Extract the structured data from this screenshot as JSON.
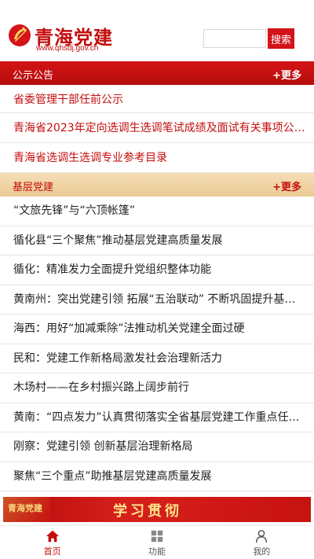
{
  "header": {
    "title": "青海党建",
    "url": "www.qhsdj.gov.cn",
    "search_placeholder": "",
    "search_button": "搜索"
  },
  "notice": {
    "title": "公示公告",
    "more": "+更多",
    "items": [
      "省委管理干部任前公示",
      "青海省2023年定向选调生选调笔试成绩及面试有关事项公…",
      "青海省选调生选调专业参考目录"
    ]
  },
  "grassroots": {
    "title": "基层党建",
    "more": "+更多",
    "items": [
      "“文旅先锋”与“六顶帐篷”",
      "循化县“三个聚焦”推动基层党建高质量发展",
      "循化：精准发力全面提升党组织整体功能",
      "黄南州：突出党建引领 拓展“五治联动” 不断巩固提升基层…",
      "海西：用好“加减乘除”法推动机关党建全面过硬",
      "民和：党建工作新格局激发社会治理新活力",
      "木场村——在乡村振兴路上阔步前行",
      "黄南：“四点发力”认真贯彻落实全省基层党建工作重点任…",
      "刚察：党建引领 创新基层治理新格局",
      "聚焦“三个重点”助推基层党建高质量发展"
    ]
  },
  "banner": {
    "left_text": "青海党建",
    "center_text": "学习贯彻"
  },
  "tabs": [
    {
      "label": "首页",
      "icon": "home-icon"
    },
    {
      "label": "功能",
      "icon": "grid-icon"
    },
    {
      "label": "我的",
      "icon": "user-icon"
    }
  ],
  "colors": {
    "brand_red": "#c40d0d",
    "section_red": "#d41414",
    "section_gold": "#eccb94"
  }
}
